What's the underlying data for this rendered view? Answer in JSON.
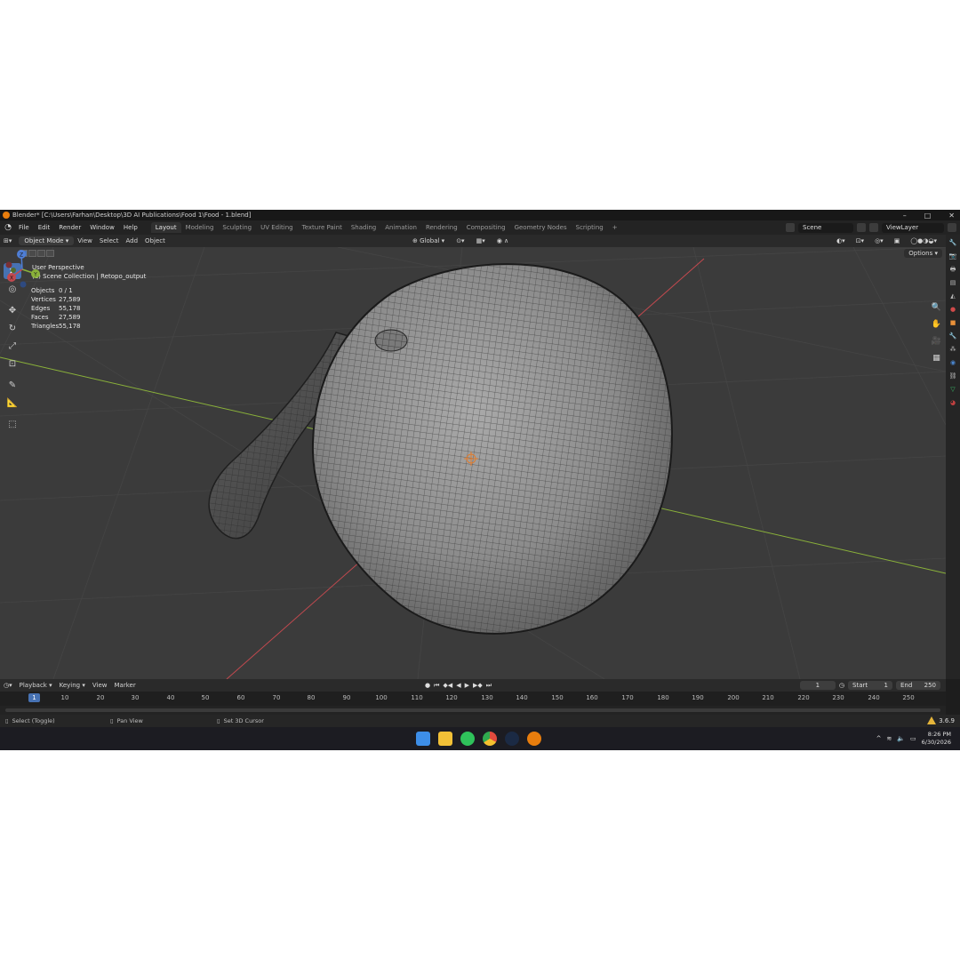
{
  "window": {
    "title": "Blender* [C:\\Users\\Farhan\\Desktop\\3D AI Publications\\Food 1\\Food - 1.blend]",
    "minimize": "–",
    "maximize": "□",
    "close": "✕"
  },
  "menubar": {
    "items": [
      "File",
      "Edit",
      "Render",
      "Window",
      "Help"
    ],
    "workspaces": [
      "Layout",
      "Modeling",
      "Sculpting",
      "UV Editing",
      "Texture Paint",
      "Shading",
      "Animation",
      "Rendering",
      "Compositing",
      "Geometry Nodes",
      "Scripting"
    ],
    "active_workspace": "Layout",
    "add_tab": "+",
    "scene": "Scene",
    "view_layer": "ViewLayer"
  },
  "viewport_header": {
    "mode": "Object Mode",
    "menus": [
      "View",
      "Select",
      "Add",
      "Object"
    ],
    "orientation": "Global",
    "options_label": "Options"
  },
  "viewport": {
    "perspective": "User Perspective",
    "collection": "(1) Scene Collection | Retopo_output",
    "stats": [
      {
        "label": "Objects",
        "value": "0 / 1"
      },
      {
        "label": "Vertices",
        "value": "27,589"
      },
      {
        "label": "Edges",
        "value": "55,178"
      },
      {
        "label": "Faces",
        "value": "27,589"
      },
      {
        "label": "Triangles",
        "value": "55,178"
      }
    ],
    "gizmo_axes": [
      "X",
      "Y",
      "Z"
    ]
  },
  "timeline": {
    "menus": [
      "Playback",
      "Keying",
      "View",
      "Marker"
    ],
    "current_frame": "1",
    "start_label": "Start",
    "start": "1",
    "end_label": "End",
    "end": "250",
    "ruler": [
      "10",
      "20",
      "30",
      "40",
      "50",
      "60",
      "70",
      "80",
      "90",
      "100",
      "110",
      "120",
      "130",
      "140",
      "150",
      "160",
      "170",
      "180",
      "190",
      "200",
      "210",
      "220",
      "230",
      "240",
      "250"
    ],
    "ruler_current": "1"
  },
  "statusbar": {
    "left": "Select (Toggle)",
    "middle": "Pan View",
    "right": "Set 3D Cursor",
    "version": "3.6.9"
  },
  "taskbar": {
    "time": "8:26 PM",
    "date": "6/30/2026",
    "apps": [
      "windows-start",
      "file-explorer",
      "whatsapp",
      "chrome",
      "steam",
      "blender"
    ]
  },
  "colors": {
    "accent": "#4772b3",
    "blender_orange": "#e87d0d",
    "viewport_bg": "#3b3b3b",
    "x_axis": "#c2494f",
    "y_axis": "#8ab13a"
  }
}
